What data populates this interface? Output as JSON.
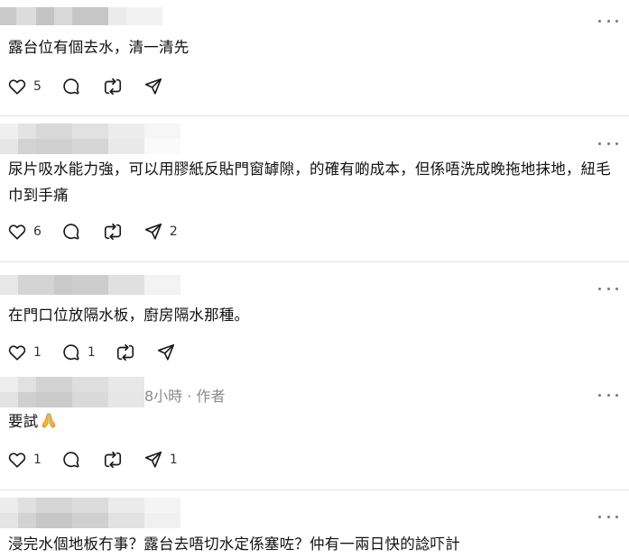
{
  "icons": {
    "like": "heart-icon",
    "reply": "comment-bubble-icon",
    "repost": "repost-arrows-icon",
    "share": "send-paper-plane-icon",
    "more": "more-horizontal-icon",
    "emoji": "folded-hands-emoji"
  },
  "colors": {
    "text": "#111111",
    "meta": "#8a8a8a",
    "icon": "#1a1a1a",
    "divider": "#e3e3e3"
  },
  "comments": [
    {
      "text": "露台位有個去水，清一清先",
      "likes": "5",
      "replies": "",
      "shares": ""
    },
    {
      "text": "尿片吸水能力強，可以用膠紙反貼門窗罅隙，的確有啲成本，但係唔洗成晚拖地抹地，紐毛巾到手痛",
      "likes": "6",
      "replies": "",
      "shares": "2"
    },
    {
      "text": "在門口位放隔水板，廚房隔水那種。",
      "likes": "1",
      "replies": "1",
      "shares": ""
    },
    {
      "meta": "8小時 · 作者",
      "text": "要試",
      "likes": "1",
      "replies": "",
      "shares": "1"
    },
    {
      "text": "浸完水個地板冇事？露台去唔切水定係塞咗？仲有一兩日快的諗吓計"
    }
  ]
}
